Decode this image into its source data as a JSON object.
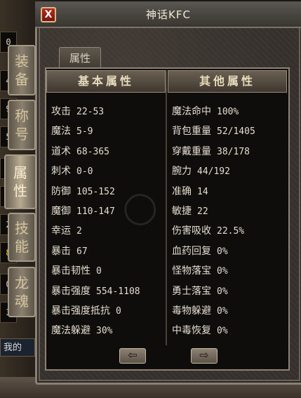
{
  "window": {
    "title": "神话KFC",
    "close_label": "X"
  },
  "background": {
    "left_cells": [
      "0",
      "4",
      "9",
      "5",
      "4",
      "6",
      "2",
      "8",
      "0",
      "3"
    ],
    "bottom_button": "我的"
  },
  "side_tabs": [
    {
      "label": [
        "装",
        "备"
      ]
    },
    {
      "label": [
        "称",
        "号"
      ]
    },
    {
      "label": [
        "属",
        "性"
      ]
    },
    {
      "label": [
        "技",
        "能"
      ]
    },
    {
      "label": [
        "龙",
        "魂"
      ]
    }
  ],
  "panel": {
    "tab_label": "属性",
    "left_header": "基本属性",
    "right_header": "其他属性",
    "left_stats": [
      {
        "label": "攻击",
        "value": "22-53"
      },
      {
        "label": "魔法",
        "value": "5-9"
      },
      {
        "label": "道术",
        "value": "68-365"
      },
      {
        "label": "刺术",
        "value": "0-0"
      },
      {
        "label": "防御",
        "value": "105-152"
      },
      {
        "label": "魔御",
        "value": "110-147"
      },
      {
        "label": "幸运",
        "value": "2"
      },
      {
        "label": "暴击",
        "value": "67"
      },
      {
        "label": "暴击韧性",
        "value": "0"
      },
      {
        "label": "暴击强度",
        "value": "554-1108"
      },
      {
        "label": "暴击强度抵抗",
        "value": "0"
      },
      {
        "label": "魔法躲避",
        "value": "30%"
      }
    ],
    "right_stats": [
      {
        "label": "魔法命中",
        "value": "100%"
      },
      {
        "label": "背包重量",
        "value": "52/1405"
      },
      {
        "label": "穿戴重量",
        "value": "38/178"
      },
      {
        "label": "腕力",
        "value": "44/192"
      },
      {
        "label": "准确",
        "value": "14"
      },
      {
        "label": "敏捷",
        "value": "22"
      },
      {
        "label": "伤害吸收",
        "value": "22.5%"
      },
      {
        "label": "血药回复",
        "value": "0%"
      },
      {
        "label": "怪物落宝",
        "value": "0%"
      },
      {
        "label": "勇士落宝",
        "value": "0%"
      },
      {
        "label": "毒物躲避",
        "value": "0%"
      },
      {
        "label": "中毒恢复",
        "value": "0%"
      }
    ],
    "prev_icon": "left-arrow-icon",
    "next_icon": "right-arrow-icon"
  }
}
